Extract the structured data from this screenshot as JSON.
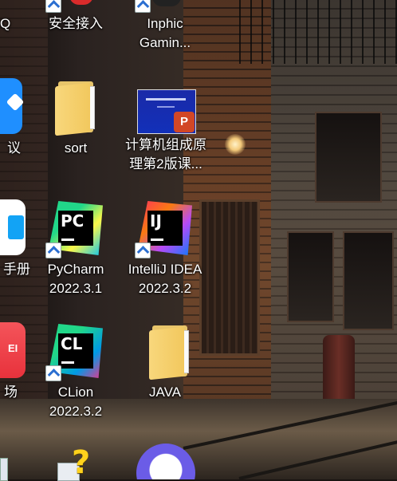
{
  "desktop": {
    "icons": [
      {
        "label": "QQ",
        "icon": "qq-icon"
      },
      {
        "label": "安全接入",
        "icon": "secure-access-icon"
      },
      {
        "label": "Inphic Gamin...",
        "icon": "inphic-gaming-icon"
      },
      {
        "label": "议",
        "icon": "meeting-app-icon"
      },
      {
        "label": "sort",
        "icon": "folder-icon"
      },
      {
        "label": "计算机组成原理第2版课...",
        "icon": "powerpoint-file-icon"
      },
      {
        "label": "手册",
        "icon": "manual-app-icon"
      },
      {
        "label": "PyCharm 2022.3.1",
        "icon": "pycharm-icon"
      },
      {
        "label": "IntelliJ IDEA 2022.3.2",
        "icon": "intellij-idea-icon"
      },
      {
        "label": "场",
        "icon": "huawei-appgallery-icon"
      },
      {
        "label": "CLion 2022.3.2",
        "icon": "clion-icon"
      },
      {
        "label": "JAVA",
        "icon": "folder-icon"
      }
    ],
    "logo_text": {
      "pycharm": "PC",
      "idea": "IJ",
      "clion": "CL",
      "huawei": "EI",
      "ppt": "P"
    }
  },
  "colors": {
    "pycharm": [
      "#21d789",
      "#fcf84a",
      "#07c3f2"
    ],
    "idea": [
      "#fe315d",
      "#f97a12",
      "#087cfa",
      "#b74af7"
    ],
    "clion": [
      "#21d789",
      "#009ae5",
      "#ed358c"
    ],
    "folder": "#f2c85e"
  }
}
